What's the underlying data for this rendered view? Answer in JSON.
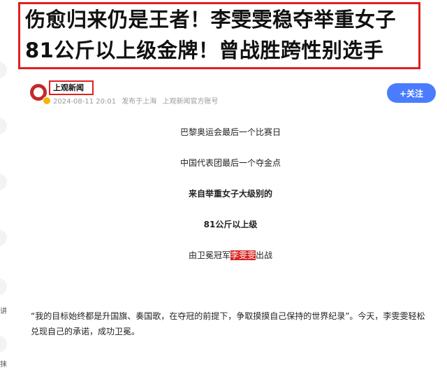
{
  "headline": {
    "line1": "伤愈归来仍是王者！李雯雯稳夺举重女子",
    "line2": "81公斤以上级金牌！曾战胜跨性别选手"
  },
  "source": {
    "name": "上观新闻",
    "date": "2024-08-11 20:01",
    "location": "发布于上海",
    "account": "上观新闻官方账号"
  },
  "follow_label": "+关注",
  "body": {
    "line1": "巴黎奥运会最后一个比赛日",
    "line2": "中国代表团最后一个夺金点",
    "line3": "来自举重女子大级别的",
    "line4": "81公斤以上级",
    "line5_before": "由卫冕冠军",
    "line5_highlight": "李雯雯",
    "line5_after": "出战",
    "quote": "“我的目标始终都是升国旗、奏国歌，在夺冠的前提下，争取摸摸自己保持的世界纪录”。今天，李雯雯轻松兑现自己的承诺，成功卫冕。"
  },
  "left_rail": {
    "label1": "讲",
    "label2": "抹"
  },
  "colors": {
    "highlight_border": "#e02020",
    "follow_button": "#4a7cff",
    "name_highlight": "#d62020"
  }
}
